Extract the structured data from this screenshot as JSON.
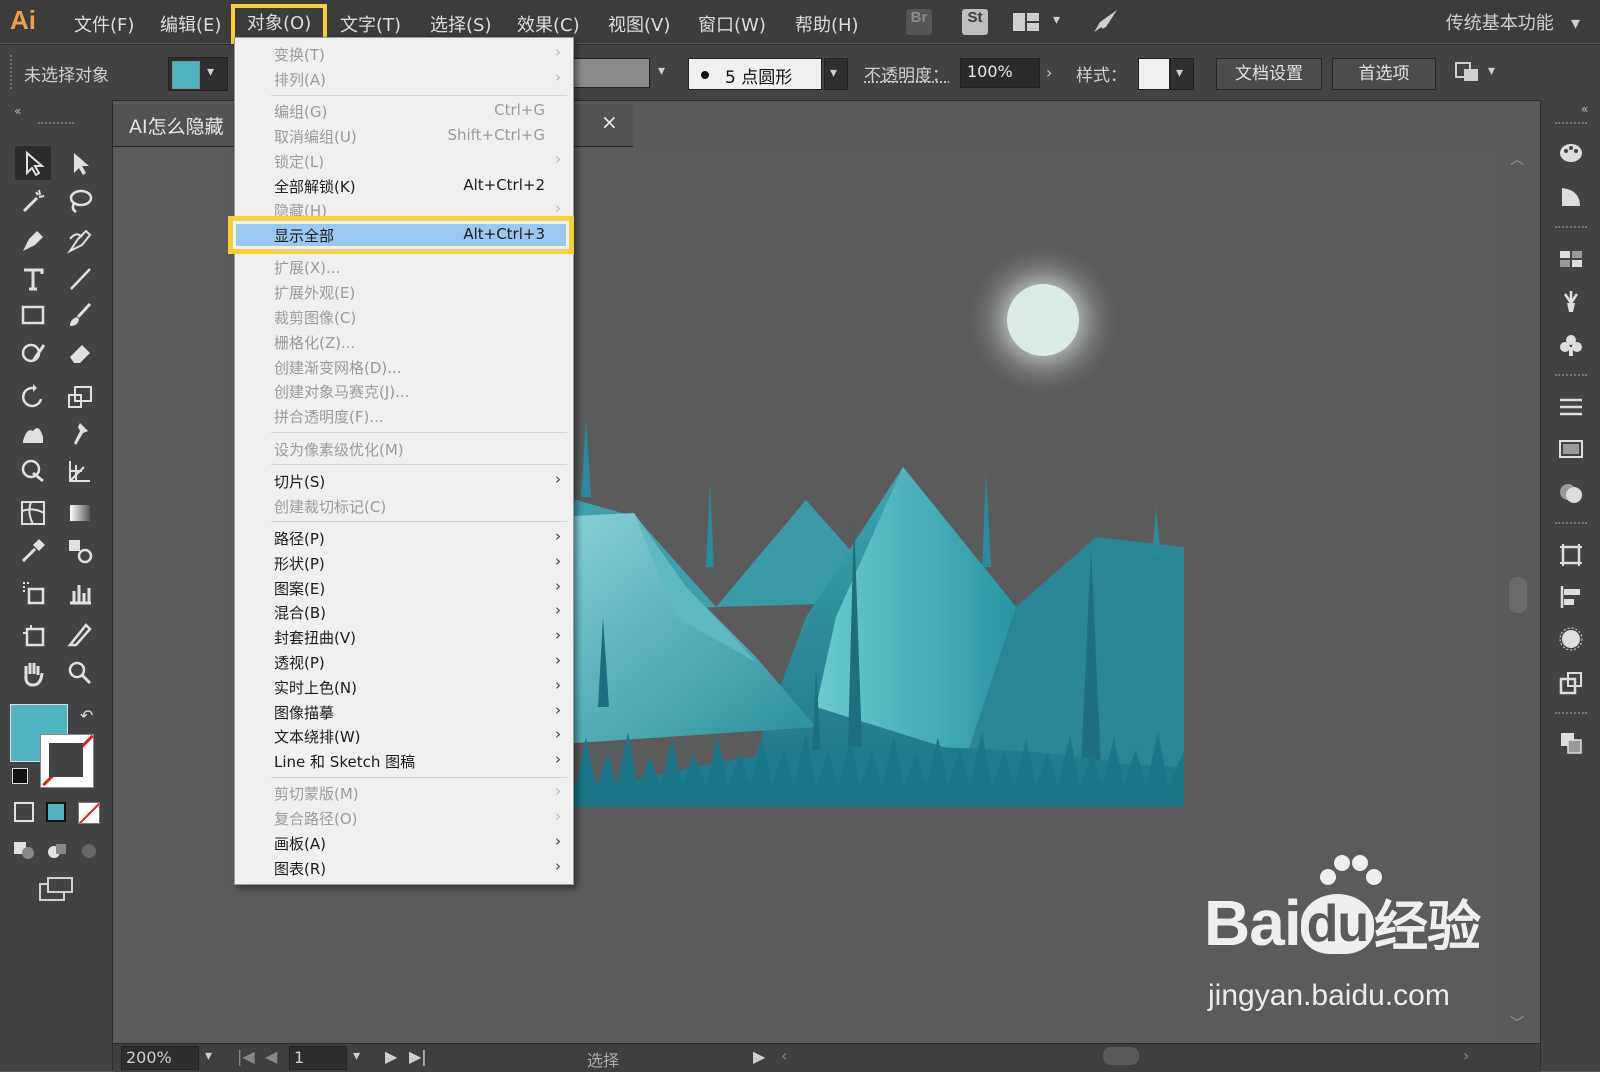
{
  "app": {
    "logo": "Ai",
    "workspace": "传统基本功能"
  },
  "menubar": {
    "items": [
      "文件(F)",
      "编辑(E)",
      "对象(O)",
      "文字(T)",
      "选择(S)",
      "效果(C)",
      "视图(V)",
      "窗口(W)",
      "帮助(H)"
    ],
    "active": "对象(O)",
    "bridge_label": "Br",
    "stock_label": "St"
  },
  "controlbar": {
    "no_selection": "未选择对象",
    "fill_color": "#4fb3c0",
    "brush_label": "5 点圆形",
    "opacity_label": "不透明度：",
    "opacity_value": "100%",
    "style_label": "样式：",
    "doc_setup": "文档设置",
    "preferences": "首选项"
  },
  "document": {
    "tab_title": "AI怎么隐藏",
    "tab_suffix": ")",
    "zoom": "200%",
    "artboard": "1",
    "status": "选择"
  },
  "object_menu": [
    {
      "label": "变换(T)",
      "shortcut": "",
      "submenu": true,
      "disabled": true
    },
    {
      "label": "排列(A)",
      "shortcut": "",
      "submenu": true,
      "disabled": true
    },
    {
      "sep": true
    },
    {
      "label": "编组(G)",
      "shortcut": "Ctrl+G",
      "submenu": false,
      "disabled": true
    },
    {
      "label": "取消编组(U)",
      "shortcut": "Shift+Ctrl+G",
      "submenu": false,
      "disabled": true
    },
    {
      "label": "锁定(L)",
      "shortcut": "",
      "submenu": true,
      "disabled": true
    },
    {
      "label": "全部解锁(K)",
      "shortcut": "Alt+Ctrl+2",
      "submenu": false,
      "disabled": false
    },
    {
      "label": "隐藏(H)",
      "shortcut": "",
      "submenu": true,
      "disabled": true
    },
    {
      "label": "显示全部",
      "shortcut": "Alt+Ctrl+3",
      "submenu": false,
      "disabled": false,
      "highlighted": true
    },
    {
      "sep": true
    },
    {
      "label": "扩展(X)...",
      "shortcut": "",
      "submenu": false,
      "disabled": true
    },
    {
      "label": "扩展外观(E)",
      "shortcut": "",
      "submenu": false,
      "disabled": true
    },
    {
      "label": "裁剪图像(C)",
      "shortcut": "",
      "submenu": false,
      "disabled": true
    },
    {
      "label": "栅格化(Z)...",
      "shortcut": "",
      "submenu": false,
      "disabled": true
    },
    {
      "label": "创建渐变网格(D)...",
      "shortcut": "",
      "submenu": false,
      "disabled": true
    },
    {
      "label": "创建对象马赛克(J)...",
      "shortcut": "",
      "submenu": false,
      "disabled": true
    },
    {
      "label": "拼合透明度(F)...",
      "shortcut": "",
      "submenu": false,
      "disabled": true
    },
    {
      "sep": true
    },
    {
      "label": "设为像素级优化(M)",
      "shortcut": "",
      "submenu": false,
      "disabled": true
    },
    {
      "sep": true
    },
    {
      "label": "切片(S)",
      "shortcut": "",
      "submenu": true,
      "disabled": false
    },
    {
      "label": "创建裁切标记(C)",
      "shortcut": "",
      "submenu": false,
      "disabled": true
    },
    {
      "sep": true
    },
    {
      "label": "路径(P)",
      "shortcut": "",
      "submenu": true,
      "disabled": false
    },
    {
      "label": "形状(P)",
      "shortcut": "",
      "submenu": true,
      "disabled": false
    },
    {
      "label": "图案(E)",
      "shortcut": "",
      "submenu": true,
      "disabled": false
    },
    {
      "label": "混合(B)",
      "shortcut": "",
      "submenu": true,
      "disabled": false
    },
    {
      "label": "封套扭曲(V)",
      "shortcut": "",
      "submenu": true,
      "disabled": false
    },
    {
      "label": "透视(P)",
      "shortcut": "",
      "submenu": true,
      "disabled": false
    },
    {
      "label": "实时上色(N)",
      "shortcut": "",
      "submenu": true,
      "disabled": false
    },
    {
      "label": "图像描摹",
      "shortcut": "",
      "submenu": true,
      "disabled": false
    },
    {
      "label": "文本绕排(W)",
      "shortcut": "",
      "submenu": true,
      "disabled": false
    },
    {
      "label": "Line 和 Sketch 图稿",
      "shortcut": "",
      "submenu": true,
      "disabled": false
    },
    {
      "sep": true
    },
    {
      "label": "剪切蒙版(M)",
      "shortcut": "",
      "submenu": true,
      "disabled": true
    },
    {
      "label": "复合路径(O)",
      "shortcut": "",
      "submenu": true,
      "disabled": true
    },
    {
      "label": "画板(A)",
      "shortcut": "",
      "submenu": true,
      "disabled": false
    },
    {
      "label": "图表(R)",
      "shortcut": "",
      "submenu": true,
      "disabled": false
    }
  ],
  "watermark": {
    "brand": "Bai",
    "brand_du": "du",
    "brand_suffix": "经验",
    "url": "jingyan.baidu.com"
  },
  "colors": {
    "accent_highlight": "#f5d132",
    "menu_selection": "#99c9f3",
    "art_teal": "#2a8b97"
  }
}
